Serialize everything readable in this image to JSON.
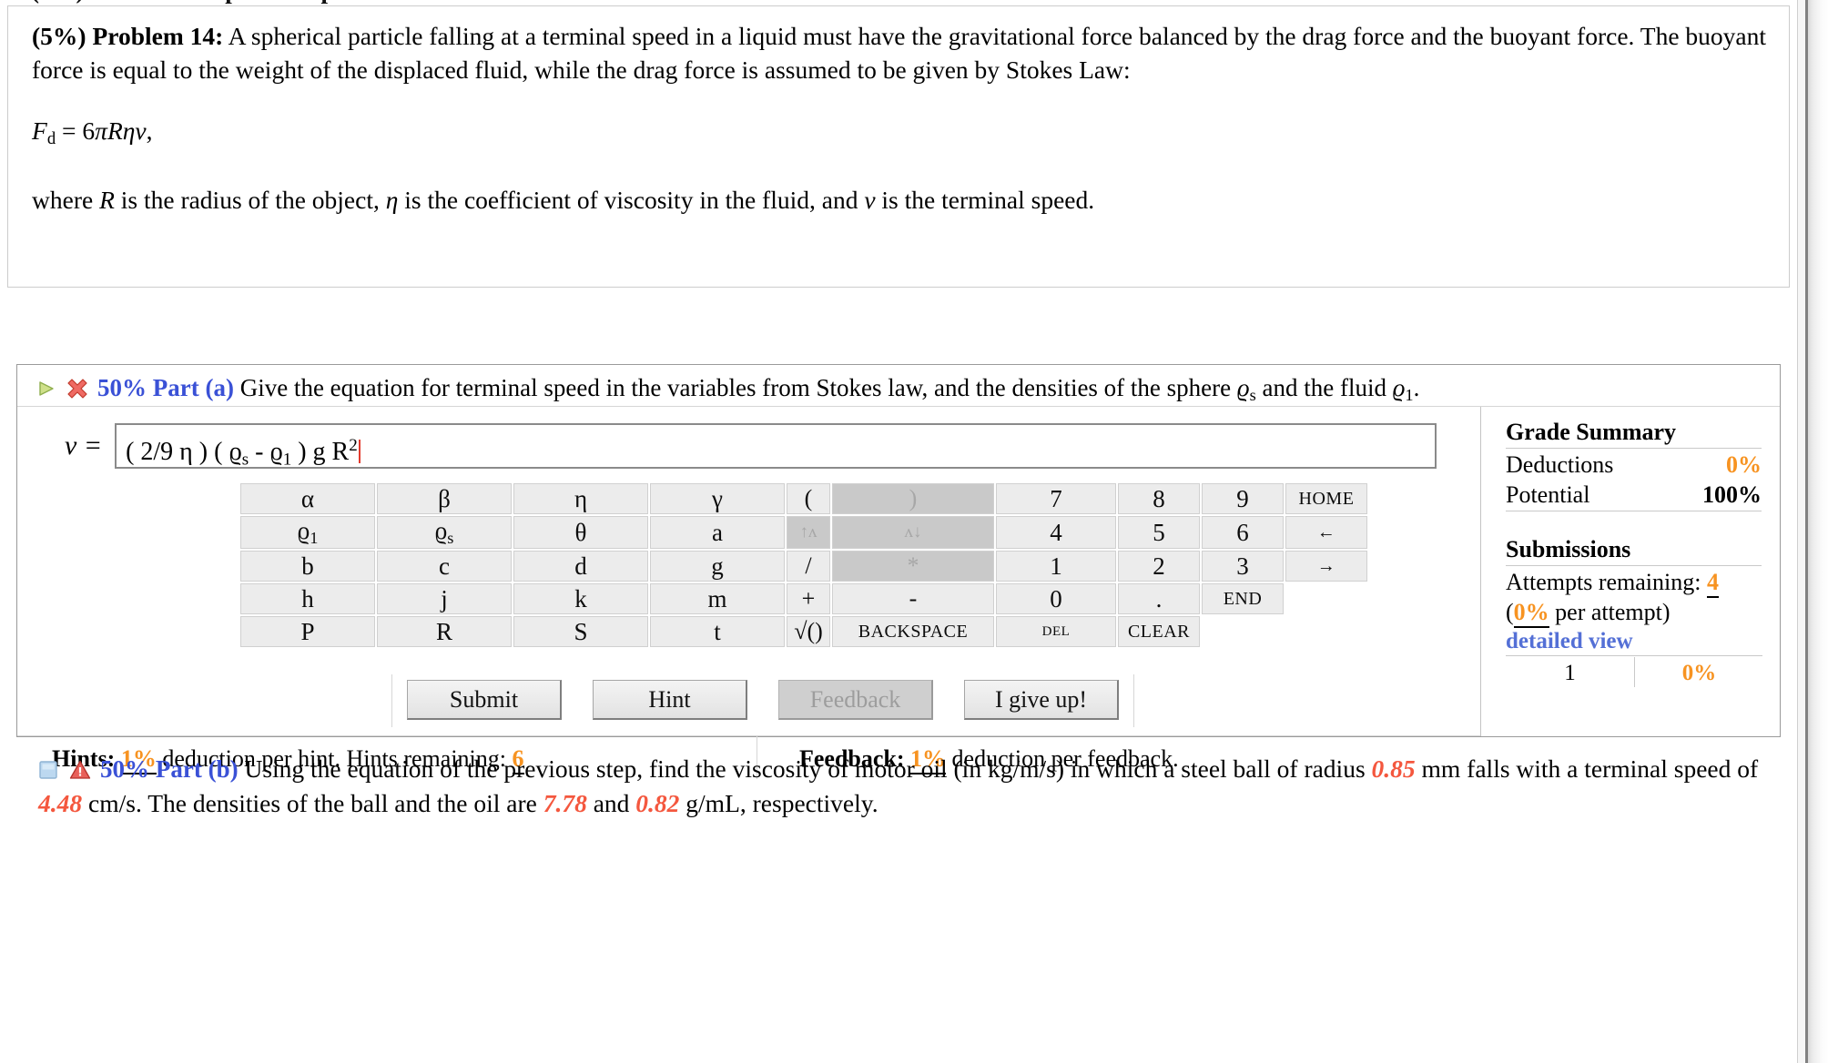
{
  "statement": {
    "percent_label": "(5%)",
    "problem_label": "Problem 14:",
    "body_1": "A spherical particle falling at a terminal speed in a liquid must have the gravitational force balanced by the drag force and the buoyant force. The buoyant force is equal to the weight of the displaced fluid, while the drag force is assumed to be given by Stokes Law:",
    "equation": "F_d = 6πRηv,",
    "equation_parts": {
      "lhs_var": "F",
      "lhs_sub": "d",
      "eq": " = 6",
      "pi": "π",
      "R": "R",
      "eta": "η",
      "v": "v",
      "comma": ","
    },
    "body_2_a": "where ",
    "body_2_R": "R",
    "body_2_b": " is the radius of the object, ",
    "body_2_eta": "η",
    "body_2_c": " is the coefficient of viscosity in the fluid, and ",
    "body_2_v": "v",
    "body_2_d": " is the terminal speed."
  },
  "part_a": {
    "play_icon": "play-triangle-icon",
    "status_icon": "red-x-icon",
    "percent": "50%",
    "title": "Part (a)",
    "prompt_1": "Give the equation for terminal speed in the variables from Stokes law, and the densities of the sphere ",
    "rho_s": "ϱ",
    "rho_s_sub": "s",
    "prompt_2": " and the fluid ",
    "rho_1": "ϱ",
    "rho_1_sub": "1",
    "prompt_3": ".",
    "answer_label": "v =",
    "answer_value": "( 2/9 η ) ( ϱs - ϱ1 ) g R2",
    "answer_tokens": [
      {
        "t": "( 2/9 η ) ( "
      },
      {
        "t": "ϱ"
      },
      {
        "t": "s",
        "k": "sub"
      },
      {
        "t": " - "
      },
      {
        "t": "ϱ"
      },
      {
        "t": "1",
        "k": "sub"
      },
      {
        "t": " ) g R"
      },
      {
        "t": "2",
        "k": "sup"
      }
    ],
    "caret_color": "#e33b2e"
  },
  "keypad": {
    "rows": [
      [
        {
          "label": "α",
          "cls": "var",
          "disabled": false,
          "name": "key-alpha"
        },
        {
          "label": "β",
          "cls": "var",
          "disabled": false,
          "name": "key-beta"
        },
        {
          "label": "η",
          "cls": "var",
          "disabled": false,
          "name": "key-eta"
        },
        {
          "label": "γ",
          "cls": "var",
          "disabled": false,
          "name": "key-gamma"
        },
        {
          "label": "(",
          "cls": "op",
          "disabled": false,
          "name": "key-open-paren"
        },
        {
          "label": ")",
          "cls": "op",
          "disabled": true,
          "name": "key-close-paren"
        },
        {
          "label": "7",
          "cls": "num",
          "disabled": false,
          "name": "key-7"
        },
        {
          "label": "8",
          "cls": "num",
          "disabled": false,
          "name": "key-8"
        },
        {
          "label": "9",
          "cls": "num",
          "disabled": false,
          "name": "key-9"
        },
        {
          "label": "HOME",
          "cls": "nav",
          "disabled": false,
          "name": "key-home"
        }
      ],
      [
        {
          "label": "ϱ1",
          "cls": "var",
          "disabled": false,
          "name": "key-rho-1",
          "sub": "1",
          "base": "ϱ"
        },
        {
          "label": "ϱs",
          "cls": "var",
          "disabled": false,
          "name": "key-rho-s",
          "sub": "s",
          "base": "ϱ"
        },
        {
          "label": "θ",
          "cls": "var",
          "disabled": false,
          "name": "key-theta"
        },
        {
          "label": "a",
          "cls": "var",
          "disabled": false,
          "name": "key-a"
        },
        {
          "label": "↑ʌ",
          "cls": "op small",
          "disabled": true,
          "name": "key-power-up"
        },
        {
          "label": "ʌ↓",
          "cls": "op small",
          "disabled": true,
          "name": "key-power-down"
        },
        {
          "label": "4",
          "cls": "num",
          "disabled": false,
          "name": "key-4"
        },
        {
          "label": "5",
          "cls": "num",
          "disabled": false,
          "name": "key-5"
        },
        {
          "label": "6",
          "cls": "num",
          "disabled": false,
          "name": "key-6"
        },
        {
          "label": "←",
          "cls": "nav",
          "disabled": false,
          "name": "key-arrow-left"
        }
      ],
      [
        {
          "label": "b",
          "cls": "var",
          "disabled": false,
          "name": "key-b"
        },
        {
          "label": "c",
          "cls": "var",
          "disabled": false,
          "name": "key-c"
        },
        {
          "label": "d",
          "cls": "var",
          "disabled": false,
          "name": "key-d"
        },
        {
          "label": "g",
          "cls": "var",
          "disabled": false,
          "name": "key-g"
        },
        {
          "label": "/",
          "cls": "op",
          "disabled": false,
          "name": "key-divide"
        },
        {
          "label": "*",
          "cls": "op",
          "disabled": true,
          "name": "key-multiply"
        },
        {
          "label": "1",
          "cls": "num",
          "disabled": false,
          "name": "key-1"
        },
        {
          "label": "2",
          "cls": "num",
          "disabled": false,
          "name": "key-2"
        },
        {
          "label": "3",
          "cls": "num",
          "disabled": false,
          "name": "key-3"
        },
        {
          "label": "→",
          "cls": "nav",
          "disabled": false,
          "name": "key-arrow-right"
        }
      ],
      [
        {
          "label": "h",
          "cls": "var",
          "disabled": false,
          "name": "key-h"
        },
        {
          "label": "j",
          "cls": "var",
          "disabled": false,
          "name": "key-j"
        },
        {
          "label": "k",
          "cls": "var",
          "disabled": false,
          "name": "key-k"
        },
        {
          "label": "m",
          "cls": "var",
          "disabled": false,
          "name": "key-m"
        },
        {
          "label": "+",
          "cls": "op",
          "disabled": false,
          "name": "key-plus"
        },
        {
          "label": "-",
          "cls": "op",
          "disabled": false,
          "name": "key-minus"
        },
        {
          "label": "0",
          "cls": "zero",
          "disabled": false,
          "name": "key-0"
        },
        {
          "label": ".",
          "cls": "dot",
          "disabled": false,
          "name": "key-decimal"
        },
        {
          "label": "END",
          "cls": "nav",
          "disabled": false,
          "name": "key-end"
        }
      ],
      [
        {
          "label": "P",
          "cls": "var",
          "disabled": false,
          "name": "key-P"
        },
        {
          "label": "R",
          "cls": "var",
          "disabled": false,
          "name": "key-R"
        },
        {
          "label": "S",
          "cls": "var",
          "disabled": false,
          "name": "key-S"
        },
        {
          "label": "t",
          "cls": "var",
          "disabled": false,
          "name": "key-t"
        },
        {
          "label": "√()",
          "cls": "op",
          "disabled": false,
          "name": "key-sqrt"
        },
        {
          "label": "BACKSPACE",
          "cls": "bksp",
          "disabled": false,
          "name": "key-backspace"
        },
        {
          "label": "DEL",
          "cls": "del",
          "disabled": false,
          "name": "key-del"
        },
        {
          "label": "CLEAR",
          "cls": "clear",
          "disabled": false,
          "name": "key-clear"
        }
      ]
    ]
  },
  "buttons": {
    "submit": "Submit",
    "hint": "Hint",
    "feedback": "Feedback",
    "give_up": "I give up!"
  },
  "footer": {
    "hints_label": "Hints:",
    "hints_pct": "1%",
    "hints_text_1": "deduction per hint. Hints remaining:",
    "hints_remaining": "6",
    "feedback_label": "Feedback:",
    "feedback_pct": "1%",
    "feedback_text": "deduction per feedback."
  },
  "grade_summary": {
    "title": "Grade Summary",
    "deductions_label": "Deductions",
    "deductions_value": "0%",
    "potential_label": "Potential",
    "potential_value": "100%",
    "submissions_title": "Submissions",
    "attempts_label": "Attempts remaining:",
    "attempts_value": "4",
    "per_attempt_open": "(",
    "per_attempt_pct": "0%",
    "per_attempt_text": "per attempt)",
    "detailed_view": "detailed view",
    "table": [
      {
        "n": "1",
        "pct": "0%"
      }
    ]
  },
  "part_b": {
    "square_icon": "blue-square-icon",
    "status_icon": "red-warning-triangle-icon",
    "percent": "50%",
    "title": "Part (b)",
    "text_1": "Using the equation of the previous step, find the viscosity of motor oil (in kg/m/s) in which a steel ball of radius ",
    "radius": "0.85",
    "text_2": " mm falls with a terminal speed of ",
    "speed": "4.48",
    "text_3": " cm/s. The densities of the ball and the oil are ",
    "density_ball": "7.78",
    "text_4": " and ",
    "density_oil": "0.82",
    "text_5": " g/mL, respectively."
  },
  "colors": {
    "accent_blue": "#3a51d6",
    "orange": "#f79321",
    "red_value": "#f4573e",
    "link_blue": "#5470d6",
    "caret_red": "#e33b2e"
  }
}
